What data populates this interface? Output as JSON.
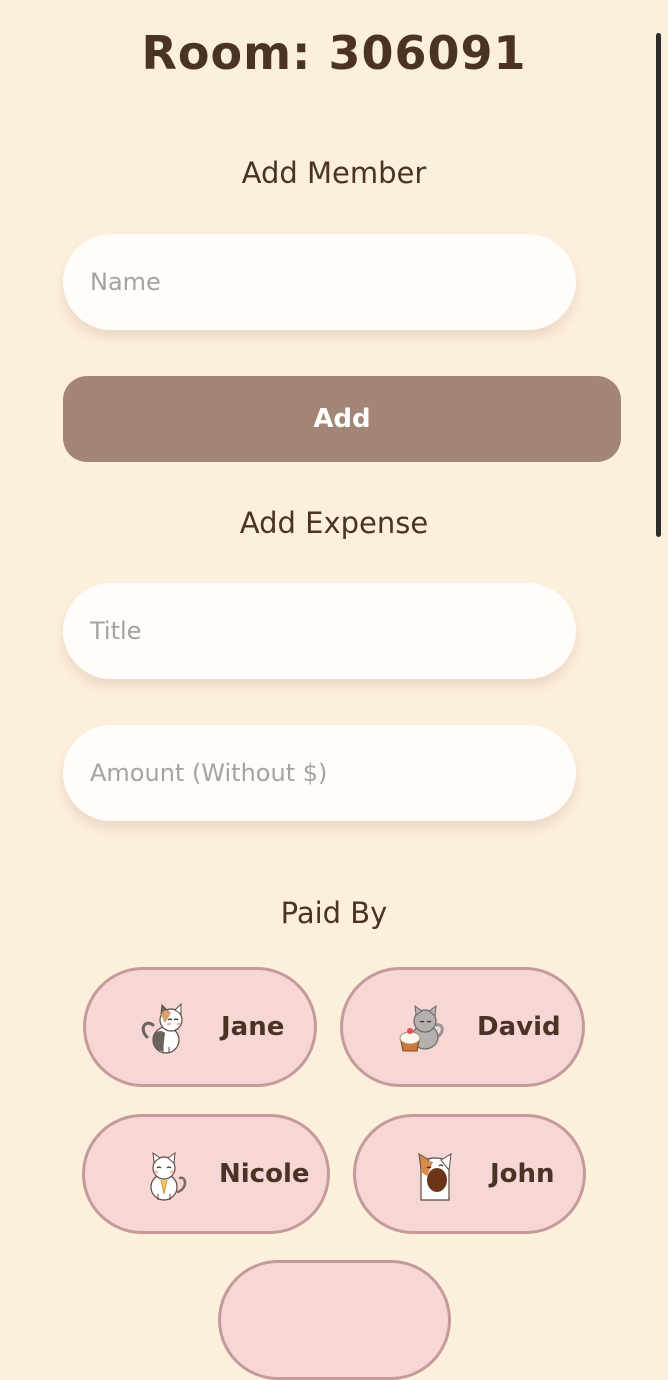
{
  "room": {
    "title": "Room: 306091"
  },
  "add_member": {
    "heading": "Add Member",
    "name_placeholder": "Name",
    "add_label": "Add"
  },
  "add_expense": {
    "heading": "Add Expense",
    "title_placeholder": "Title",
    "amount_placeholder": "Amount (Without $)"
  },
  "paid_by": {
    "heading": "Paid By",
    "members": [
      {
        "name": "Jane",
        "avatar": "calico-cat-icon"
      },
      {
        "name": "David",
        "avatar": "gray-cat-cupcake-icon"
      },
      {
        "name": "Nicole",
        "avatar": "white-cat-icon"
      },
      {
        "name": "John",
        "avatar": "cat-eating-icon"
      }
    ]
  },
  "colors": {
    "background": "#fcefdc",
    "text": "#4a3325",
    "input_background": "#fffcf9",
    "button": "#a38575",
    "pill_background": "#f7d6d6",
    "pill_border": "#c49b9a"
  }
}
